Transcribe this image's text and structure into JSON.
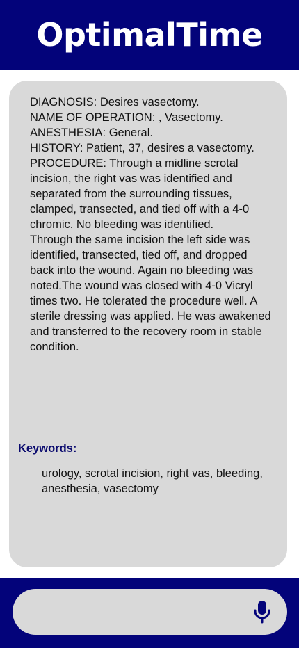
{
  "header": {
    "title": "OptimalTime"
  },
  "report": {
    "text": "DIAGNOSIS: Desires vasectomy.\nNAME OF OPERATION: , Vasectomy.\nANESTHESIA: General.\nHISTORY: Patient, 37, desires a vasectomy.\nPROCEDURE: Through a midline scrotal incision, the right vas was identified and separated from the surrounding tissues, clamped, transected, and tied off with a 4-0 chromic.  No bleeding was identified.\nThrough the same incision the left side was identified, transected, tied off, and dropped back into the wound.  Again no bleeding was noted.The wound was closed with 4-0 Vicryl times two.  He tolerated the procedure well.  A sterile dressing was applied.  He was awakened and transferred to the recovery room in stable condition."
  },
  "keywords": {
    "heading": "Keywords:",
    "text": "urology, scrotal incision, right vas, bleeding, anesthesia, vasectomy"
  },
  "input_bar": {
    "value": "",
    "placeholder": "",
    "mic_icon": "microphone-icon"
  },
  "colors": {
    "brand": "#03037a",
    "card": "#d9d9d9",
    "keywords_heading": "#0a0a6e"
  }
}
